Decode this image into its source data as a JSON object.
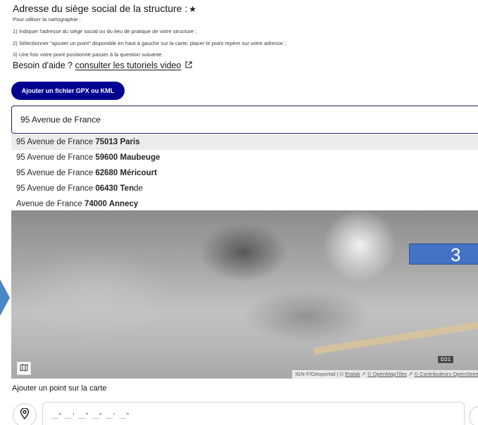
{
  "form": {
    "title": "Adresse du siège social de la structure :",
    "required_mark": "★",
    "intro": "Pour utiliser la cartographie :",
    "steps": [
      "1) Indiquer l'adresse du siège social ou du lieu de pratique de votre structure ;",
      "2) Sélectionner \"ajouter un point\" disponible en haut à gauche sur la carte, placer le point repère sur votre adresse ;",
      "3) Une fois votre point positionné passer à la question suivante."
    ],
    "help_prefix": "Besoin d'aide ?",
    "help_link": "consulter les tutoriels video",
    "help_icon": "external-link-icon",
    "gpx_button": "Ajouter un fichier GPX ou KML"
  },
  "search": {
    "value": "95 Avenue de France"
  },
  "suggestions": [
    {
      "prefix": "95 Avenue de France ",
      "bold": "75013 Paris",
      "suffix": ""
    },
    {
      "prefix": "95 Avenue de France ",
      "bold": "59600 Maubeuge",
      "suffix": ""
    },
    {
      "prefix": "95 Avenue de France ",
      "bold": "62680 Méricourt",
      "suffix": ""
    },
    {
      "prefix": "95 Avenue de France ",
      "bold": "06430 Ten",
      "suffix": "de"
    },
    {
      "prefix": "Avenue de France ",
      "bold": "74000 Annecy",
      "suffix": ""
    }
  ],
  "map": {
    "badge": "3",
    "road_label": "D21",
    "attribution_prefix": "IGN-F/Géoportail | ©",
    "attribution_links": [
      "Etalab",
      "© OpenMapTiles",
      "© Contributeurs OpenStreetMa"
    ],
    "layers_icon": "map-layers-icon"
  },
  "point": {
    "label": "Ajouter un point sur la carte",
    "pin_icon": "location-pin-icon",
    "coords_placeholder": "__° __' __\" __° __' __\""
  }
}
